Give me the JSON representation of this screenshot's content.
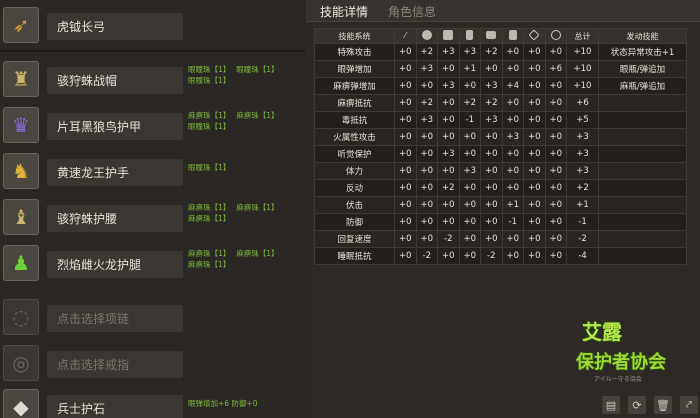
{
  "weapon": {
    "name": "虎钺长弓",
    "icon": "bow-icon"
  },
  "armor": [
    {
      "name": "骇狩蛛战帽",
      "icon": "helmet-icon",
      "jewels": [
        "眼瞳珠【1】",
        "眼瞳珠【1】",
        "眼瞳珠【1】"
      ]
    },
    {
      "name": "片耳黑狼鸟护甲",
      "icon": "chest-armor-icon",
      "jewels": [
        "麻痹珠【1】",
        "麻痹珠【1】",
        "眼瞳珠【1】"
      ]
    },
    {
      "name": "黄速龙王护手",
      "icon": "gauntlet-icon",
      "jewels": [
        "眼瞳珠【1】"
      ]
    },
    {
      "name": "骇狩蛛护腰",
      "icon": "waist-armor-icon",
      "jewels": [
        "麻痹珠【1】",
        "麻痹珠【1】",
        "麻痹珠【1】"
      ]
    },
    {
      "name": "烈焰雌火龙护腿",
      "icon": "leg-armor-icon",
      "jewels": [
        "麻痹珠【1】",
        "麻痹珠【1】",
        "麻痹珠【1】"
      ]
    }
  ],
  "necklace": {
    "placeholder": "点击选择项链",
    "icon": "necklace-icon"
  },
  "ring": {
    "placeholder": "点击选择戒指",
    "icon": "ring-icon"
  },
  "charm": {
    "name": "兵士护石",
    "icon": "charm-icon",
    "skills": "眼弹增加+6  防御+0"
  },
  "tabs": {
    "skill": "技能详情",
    "role": "角色信息"
  },
  "table": {
    "headers": {
      "system": "技能系统",
      "total": "总计",
      "active": "发动技能"
    },
    "slot_icons": [
      "weapon-icon",
      "helmet-icon",
      "chest-icon",
      "arm-icon",
      "waist-icon",
      "leg-icon",
      "charm-icon",
      "jewel-icon"
    ],
    "rows": [
      {
        "name": "特殊攻击",
        "v": [
          "+0",
          "+2",
          "+3",
          "+3",
          "+2",
          "+0",
          "+0",
          "+0"
        ],
        "total": "+10",
        "active": "状态异常攻击+1"
      },
      {
        "name": "眼弹增加",
        "v": [
          "+0",
          "+3",
          "+0",
          "+1",
          "+0",
          "+0",
          "+0",
          "+6"
        ],
        "total": "+10",
        "active": "眼瓶/弹追加"
      },
      {
        "name": "麻痹弹增加",
        "v": [
          "+0",
          "+0",
          "+3",
          "+0",
          "+3",
          "+4",
          "+0",
          "+0"
        ],
        "total": "+10",
        "active": "麻瓶/弹追加"
      },
      {
        "name": "麻痹抵抗",
        "v": [
          "+0",
          "+2",
          "+0",
          "+2",
          "+2",
          "+0",
          "+0",
          "+0"
        ],
        "total": "+6",
        "active": ""
      },
      {
        "name": "毒抵抗",
        "v": [
          "+0",
          "+3",
          "+0",
          "-1",
          "+3",
          "+0",
          "+0",
          "+0"
        ],
        "total": "+5",
        "active": ""
      },
      {
        "name": "火属性攻击",
        "v": [
          "+0",
          "+0",
          "+0",
          "+0",
          "+0",
          "+3",
          "+0",
          "+0"
        ],
        "total": "+3",
        "active": ""
      },
      {
        "name": "听觉保护",
        "v": [
          "+0",
          "+0",
          "+3",
          "+0",
          "+0",
          "+0",
          "+0",
          "+0"
        ],
        "total": "+3",
        "active": ""
      },
      {
        "name": "体力",
        "v": [
          "+0",
          "+0",
          "+0",
          "+3",
          "+0",
          "+0",
          "+0",
          "+0"
        ],
        "total": "+3",
        "active": ""
      },
      {
        "name": "反动",
        "v": [
          "+0",
          "+0",
          "+2",
          "+0",
          "+0",
          "+0",
          "+0",
          "+0"
        ],
        "total": "+2",
        "active": ""
      },
      {
        "name": "伏击",
        "v": [
          "+0",
          "+0",
          "+0",
          "+0",
          "+0",
          "+1",
          "+0",
          "+0"
        ],
        "total": "+1",
        "active": ""
      },
      {
        "name": "防御",
        "v": [
          "+0",
          "+0",
          "+0",
          "+0",
          "+0",
          "-1",
          "+0",
          "+0"
        ],
        "total": "-1",
        "active": ""
      },
      {
        "name": "回复速度",
        "v": [
          "+0",
          "+0",
          "-2",
          "+0",
          "+0",
          "+0",
          "+0",
          "+0"
        ],
        "total": "-2",
        "active": ""
      },
      {
        "name": "睡眠抵抗",
        "v": [
          "+0",
          "-2",
          "+0",
          "+0",
          "-2",
          "+0",
          "+0",
          "+0"
        ],
        "total": "-4",
        "active": ""
      }
    ]
  },
  "logo": {
    "line1": "艾露",
    "line2": "保护者协会",
    "line3": "アイルー守る協会"
  },
  "buttons": [
    "save-icon",
    "refresh-icon",
    "delete-icon",
    "share-icon"
  ]
}
